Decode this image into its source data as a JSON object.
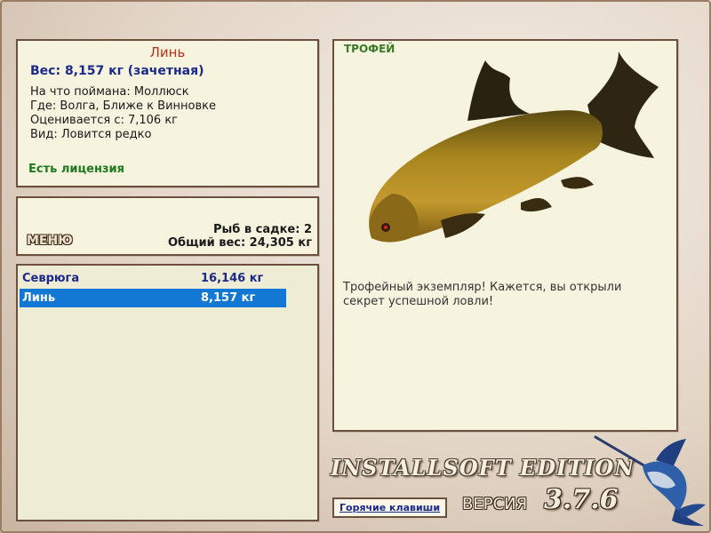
{
  "fish": {
    "name": "Линь",
    "weight_line": "Вес: 8,157 кг (зачетная)",
    "caught_on": "На что поймана: Моллюск",
    "where": "Где: Волга, Ближе к Винновке",
    "rated_from": "Оценивается с: 7,106 кг",
    "kind": "Вид: Ловится редко",
    "license": "Есть лицензия"
  },
  "menu": {
    "button_label": "МЕНЮ",
    "fish_in_cage": "Рыб в садке: 2",
    "total_weight": "Общий вес: 24,305 кг"
  },
  "catch_list": [
    {
      "name": "Севрюга",
      "weight": "16,146 кг",
      "selected": false
    },
    {
      "name": "Линь",
      "weight": "8,157 кг",
      "selected": true
    }
  ],
  "trophy": {
    "title": "ТРОФЕЙ",
    "text": "Трофейный экземпляр! Кажется, вы открыли секрет успешной ловли!"
  },
  "footer": {
    "edition": "INSTALLSOFT EDITION",
    "version_label": "ВЕРСИЯ",
    "version_number": "3.7.6",
    "hotkeys": "Горячие клавиши"
  },
  "colors": {
    "fish_name": "#b8321a",
    "weight": "#1b2a8a",
    "license": "#1d7a1d",
    "selected_row": "#1278d4",
    "trophy_title": "#3a7a28"
  },
  "icons": {
    "fish_picture": "tench-fish-icon",
    "logo": "marlin-icon"
  }
}
